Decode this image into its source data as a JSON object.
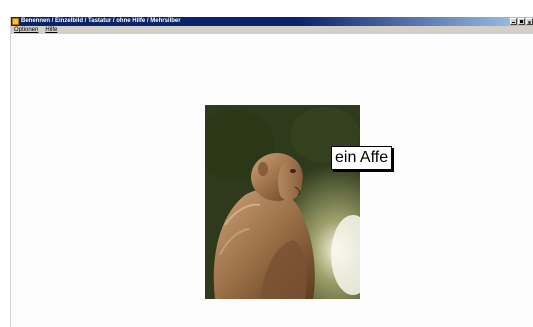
{
  "window": {
    "title": "Benennen / Einzelbild / Tastatur / ohne Hilfe / Mehrsilber"
  },
  "menu": {
    "items": [
      {
        "label": "Optionen"
      },
      {
        "label": "Hilfe"
      }
    ]
  },
  "content": {
    "image_subject": "monkey photo",
    "word_label": "ein Affe"
  },
  "colors": {
    "titlebar_start": "#0a246a",
    "titlebar_end": "#a6caf0",
    "window_face": "#d4d0c8",
    "client_bg": "#fdfdfd"
  },
  "icons": [
    "app-icon",
    "minimize-icon",
    "maximize-icon",
    "close-icon"
  ]
}
